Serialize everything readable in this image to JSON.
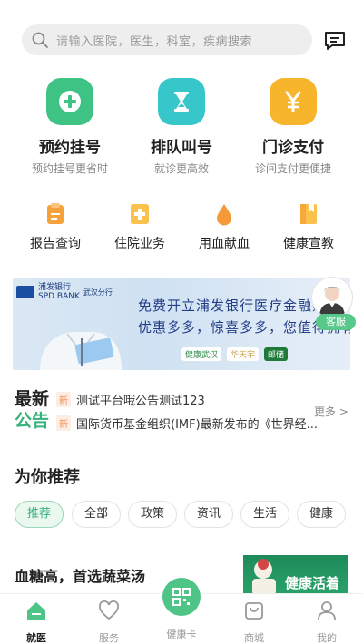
{
  "search": {
    "placeholder": "请输入医院，医生，科室，疾病搜索"
  },
  "main_features": [
    {
      "title": "预约挂号",
      "subtitle": "预约挂号更省时",
      "icon": "plus-icon",
      "color": "#3fc384"
    },
    {
      "title": "排队叫号",
      "subtitle": "就诊更高效",
      "icon": "hourglass-icon",
      "color": "#37c6c9"
    },
    {
      "title": "门诊支付",
      "subtitle": "诊间支付更便捷",
      "icon": "yen-icon",
      "color": "#f7b52c"
    }
  ],
  "sub_features": [
    {
      "title": "报告查询",
      "icon": "report-icon"
    },
    {
      "title": "住院业务",
      "icon": "hospital-icon"
    },
    {
      "title": "用血献血",
      "icon": "blood-drop-icon"
    },
    {
      "title": "健康宣教",
      "icon": "book-icon"
    }
  ],
  "banner": {
    "bank_name": "浦发银行",
    "bank_name_en": "SPD BANK",
    "branch": "武汉分行",
    "line1": "免费开立浦发银行医疗金融账",
    "line2": "优惠多多，惊喜多多，您值得拥有",
    "partners": [
      "健康武汉",
      "华天宇",
      "邮储"
    ],
    "cs_label": "客服"
  },
  "news": {
    "title_a": "最新",
    "title_b": "公告",
    "items": [
      {
        "tag": "新",
        "text": "测试平台哦公告测试123"
      },
      {
        "tag": "新",
        "text": "国际货币基金组织(IMF)最新发布的《世界经..."
      }
    ],
    "more": "更多 >"
  },
  "recommend": {
    "title": "为你推荐",
    "chips": [
      "推荐",
      "全部",
      "政策",
      "资讯",
      "生活",
      "健康"
    ],
    "active_chip": "推荐",
    "article_title": "血糖高，首选蔬菜汤",
    "article_thumb_text": "健康活着"
  },
  "bottom_nav": [
    {
      "label": "就医",
      "icon": "home-icon",
      "active": true
    },
    {
      "label": "服务",
      "icon": "heart-icon",
      "active": false
    },
    {
      "label": "健康卡",
      "icon": "qr-code-icon",
      "active": false
    },
    {
      "label": "商城",
      "icon": "shop-bag-icon",
      "active": false
    },
    {
      "label": "我的",
      "icon": "user-icon",
      "active": false
    }
  ],
  "colors": {
    "accent": "#36b27b",
    "tag": "#f08a4b"
  }
}
